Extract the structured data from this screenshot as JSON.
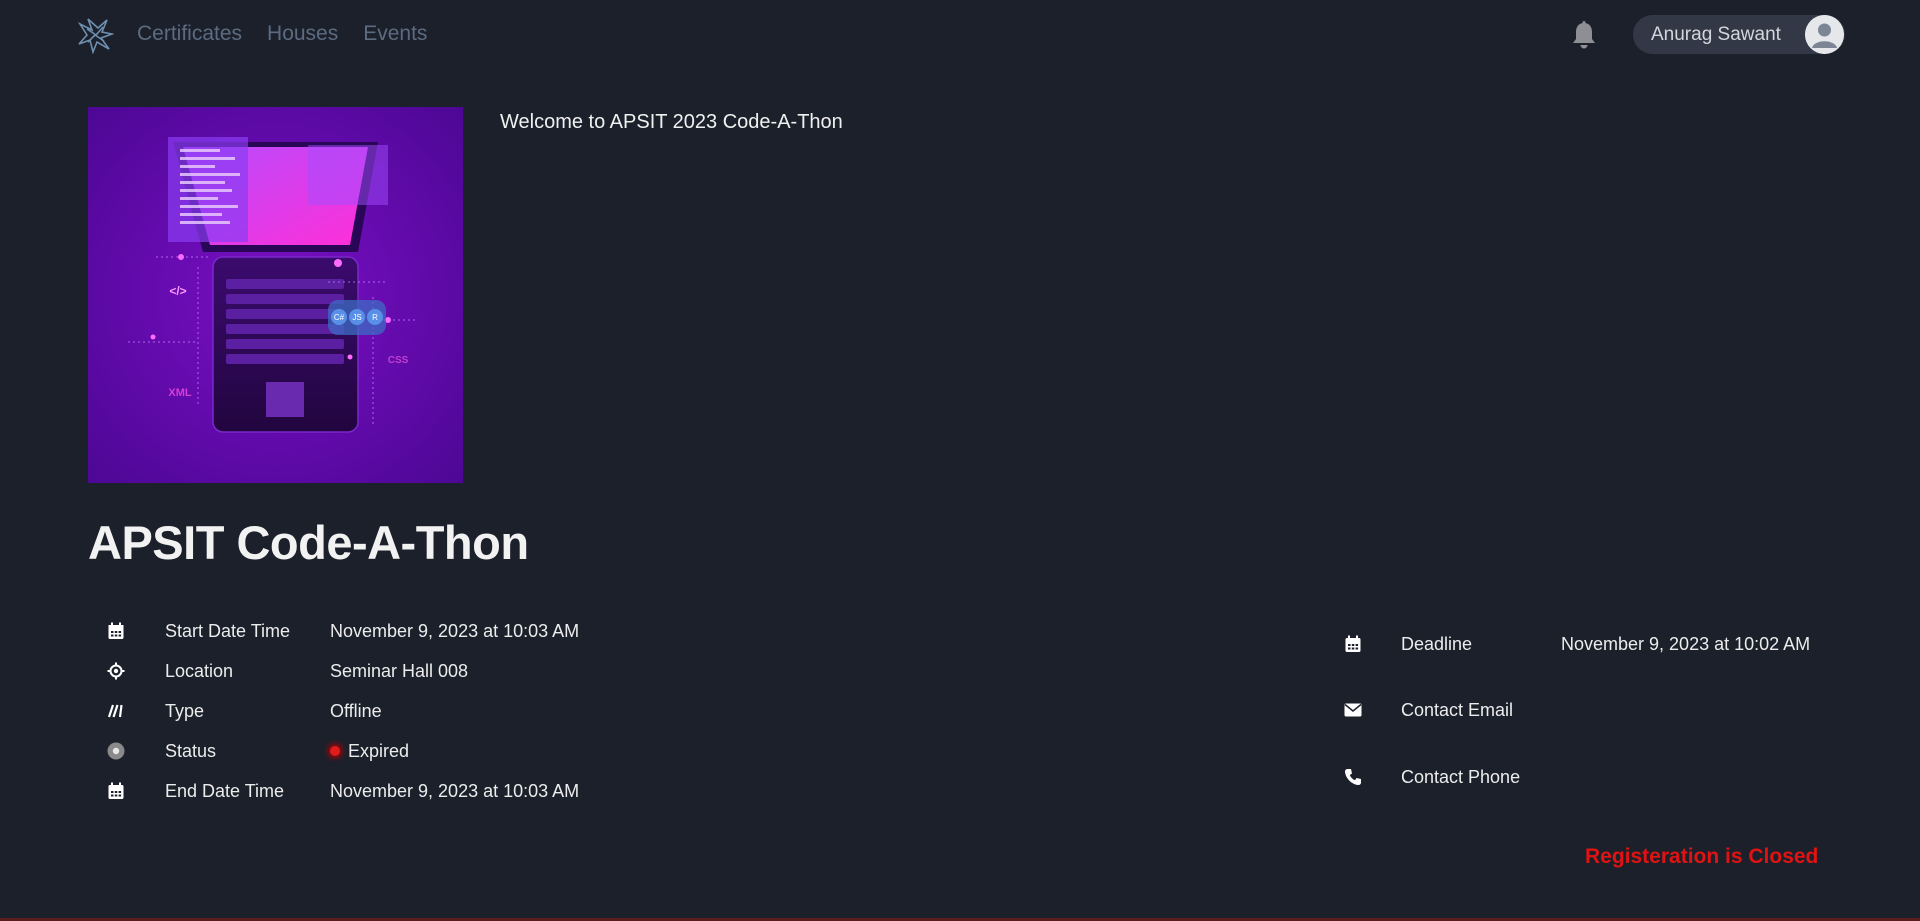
{
  "nav": {
    "links": [
      {
        "label": "Certificates"
      },
      {
        "label": "Houses"
      },
      {
        "label": "Events"
      }
    ],
    "user_name": "Anurag Sawant",
    "icons": {
      "logo": "star-burst-logo",
      "bell": "bell-icon",
      "avatar": "user-avatar-icon"
    }
  },
  "event": {
    "welcome": "Welcome to APSIT 2023 Code-A-Thon",
    "title": "APSIT Code-A-Thon",
    "image_texts": {
      "code": "</>",
      "langs": [
        "C#",
        "JS",
        "R"
      ],
      "xml": "XML",
      "css": "CSS"
    }
  },
  "details_left": [
    {
      "icon": "calendar-icon",
      "label": "Start Date Time",
      "value": "November 9, 2023 at 10:03 AM"
    },
    {
      "icon": "location-icon",
      "label": "Location",
      "value": "Seminar Hall 008"
    },
    {
      "icon": "type-icon",
      "label": "Type",
      "value": "Offline"
    },
    {
      "icon": "status-icon",
      "label": "Status",
      "value": "Expired"
    },
    {
      "icon": "calendar-icon",
      "label": "End Date Time",
      "value": "November 9, 2023 at 10:03 AM"
    }
  ],
  "details_right": [
    {
      "icon": "calendar-icon",
      "label": "Deadline",
      "value": "November 9, 2023 at 10:02 AM"
    },
    {
      "icon": "mail-icon",
      "label": "Contact Email",
      "value": ""
    },
    {
      "icon": "phone-icon",
      "label": "Contact Phone",
      "value": ""
    }
  ],
  "registration_status": "Registeration is Closed",
  "colors": {
    "background": "#1b202b",
    "status_red": "#e01313",
    "nav_link": "#5c6b80"
  }
}
